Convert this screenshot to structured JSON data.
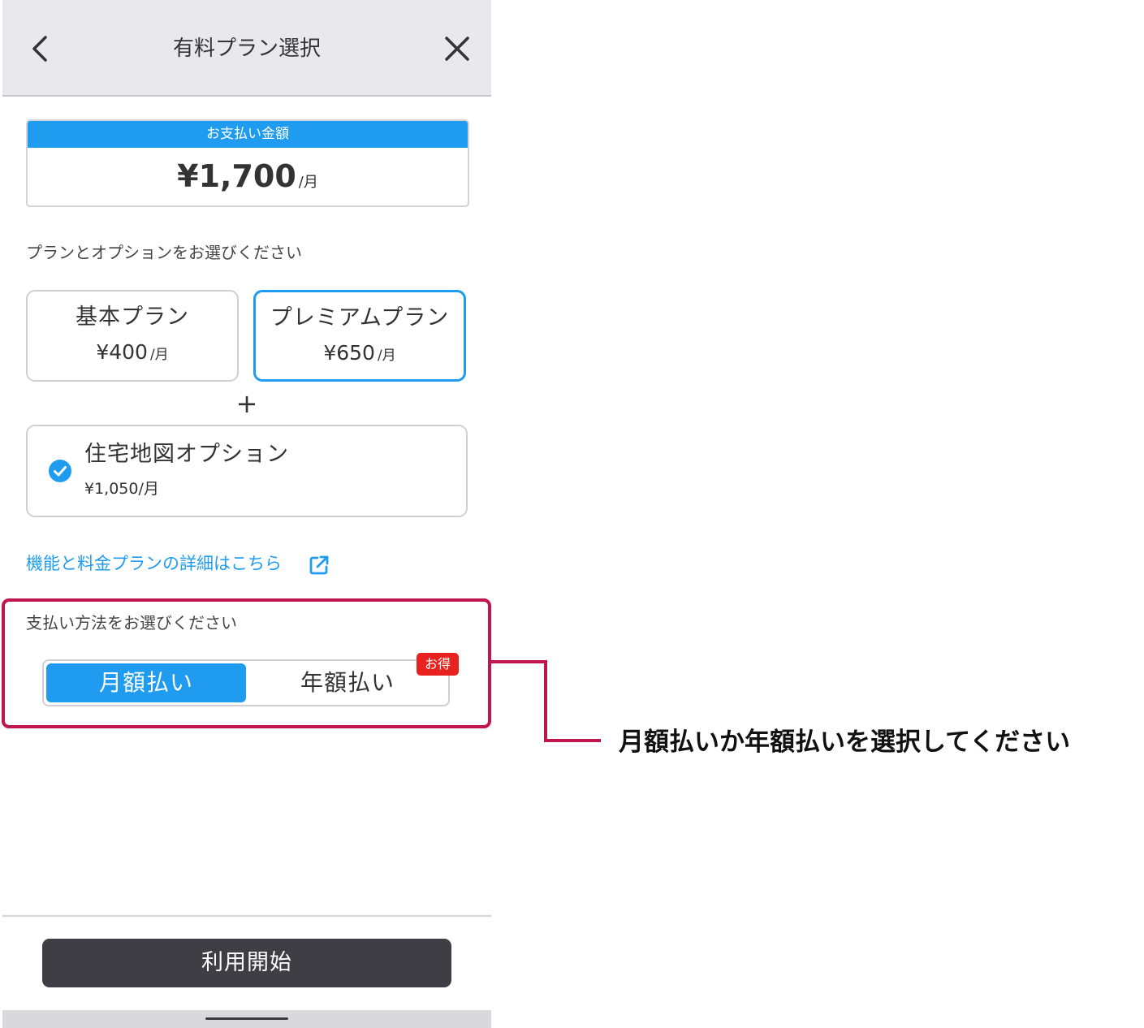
{
  "header": {
    "title": "有料プラン選択",
    "back_icon": "chevron-left-icon",
    "close_icon": "close-icon"
  },
  "payment_amount": {
    "label": "お支払い金額",
    "value": "¥1,700",
    "unit": "/月"
  },
  "plan_section": {
    "label": "プランとオプションをお選びください",
    "plans": [
      {
        "name": "基本プラン",
        "price": "¥400",
        "unit": "/月",
        "selected": false
      },
      {
        "name": "プレミアムプラン",
        "price": "¥650",
        "unit": "/月",
        "selected": true
      }
    ],
    "plus": "+"
  },
  "option": {
    "name": "住宅地図オプション",
    "price": "¥1,050/月",
    "checked": true,
    "check_icon": "check-circle-icon"
  },
  "detail_link": {
    "label": "機能と料金プランの詳細はこちら",
    "icon": "external-link-icon"
  },
  "payment_method": {
    "label": "支払い方法をお選びください",
    "options": [
      "月額払い",
      "年額払い"
    ],
    "selected": "月額払い",
    "badge": "お得"
  },
  "footer": {
    "start_button": "利用開始"
  },
  "annotation": {
    "text": "月額払いか年額払いを選択してください"
  },
  "colors": {
    "accent": "#1f9cf0",
    "badge": "#e8231f",
    "button_dark": "#3e3e44",
    "highlight": "#c0154e",
    "header_bg": "#e9e9ed"
  }
}
